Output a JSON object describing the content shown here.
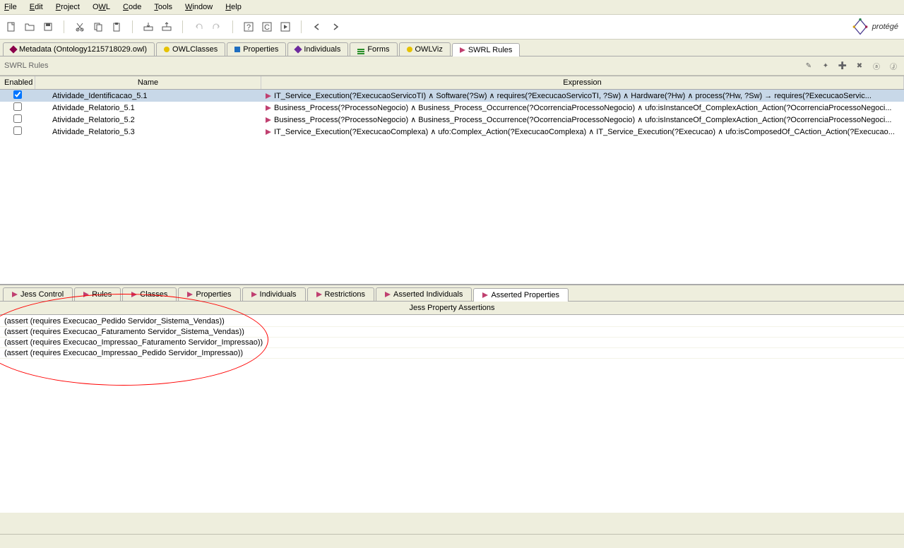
{
  "menu": [
    "File",
    "Edit",
    "Project",
    "OWL",
    "Code",
    "Tools",
    "Window",
    "Help"
  ],
  "logo_text": "protégé",
  "main_tabs": [
    {
      "label": "Metadata (Ontology1215718029.owl)",
      "icon": "ti-maroon"
    },
    {
      "label": "OWLClasses",
      "icon": "ti-yellow"
    },
    {
      "label": "Properties",
      "icon": "ti-blue"
    },
    {
      "label": "Individuals",
      "icon": "ti-purple"
    },
    {
      "label": "Forms",
      "icon": "ti-green"
    },
    {
      "label": "OWLViz",
      "icon": "ti-yellow"
    },
    {
      "label": "SWRL Rules",
      "icon": "ti-arrow",
      "active": true
    }
  ],
  "panel_title": "SWRL Rules",
  "columns": {
    "enabled": "Enabled",
    "name": "Name",
    "expression": "Expression"
  },
  "rules": [
    {
      "enabled": true,
      "selected": true,
      "name": "Atividade_Identificacao_5.1",
      "expr": "IT_Service_Execution(?ExecucaoServicoTI)  ∧  Software(?Sw)  ∧  requires(?ExecucaoServicoTI, ?Sw)  ∧  Hardware(?Hw)  ∧  process(?Hw, ?Sw) → requires(?ExecucaoServic..."
    },
    {
      "enabled": false,
      "name": "Atividade_Relatorio_5.1",
      "expr": "Business_Process(?ProcessoNegocio)  ∧  Business_Process_Occurrence(?OcorrenciaProcessoNegocio)  ∧  ufo:isInstanceOf_ComplexAction_Action(?OcorrenciaProcessoNegoci..."
    },
    {
      "enabled": false,
      "name": "Atividade_Relatorio_5.2",
      "expr": "Business_Process(?ProcessoNegocio)  ∧  Business_Process_Occurrence(?OcorrenciaProcessoNegocio)  ∧  ufo:isInstanceOf_ComplexAction_Action(?OcorrenciaProcessoNegoci..."
    },
    {
      "enabled": false,
      "name": "Atividade_Relatorio_5.3",
      "expr": "IT_Service_Execution(?ExecucaoComplexa)  ∧  ufo:Complex_Action(?ExecucaoComplexa)  ∧  IT_Service_Execution(?Execucao)  ∧  ufo:isComposedOf_CAction_Action(?Execucao..."
    }
  ],
  "bottom_tabs": [
    "Jess Control",
    "Rules",
    "Classes",
    "Properties",
    "Individuals",
    "Restrictions",
    "Asserted Individuals",
    "Asserted Properties"
  ],
  "bottom_active": 7,
  "assert_title": "Jess Property Assertions",
  "assertions": [
    "(assert (requires Execucao_Pedido Servidor_Sistema_Vendas))",
    "(assert (requires Execucao_Faturamento Servidor_Sistema_Vendas))",
    "(assert (requires Execucao_Impressao_Faturamento Servidor_Impressao))",
    "(assert (requires Execucao_Impressao_Pedido Servidor_Impressao))"
  ]
}
